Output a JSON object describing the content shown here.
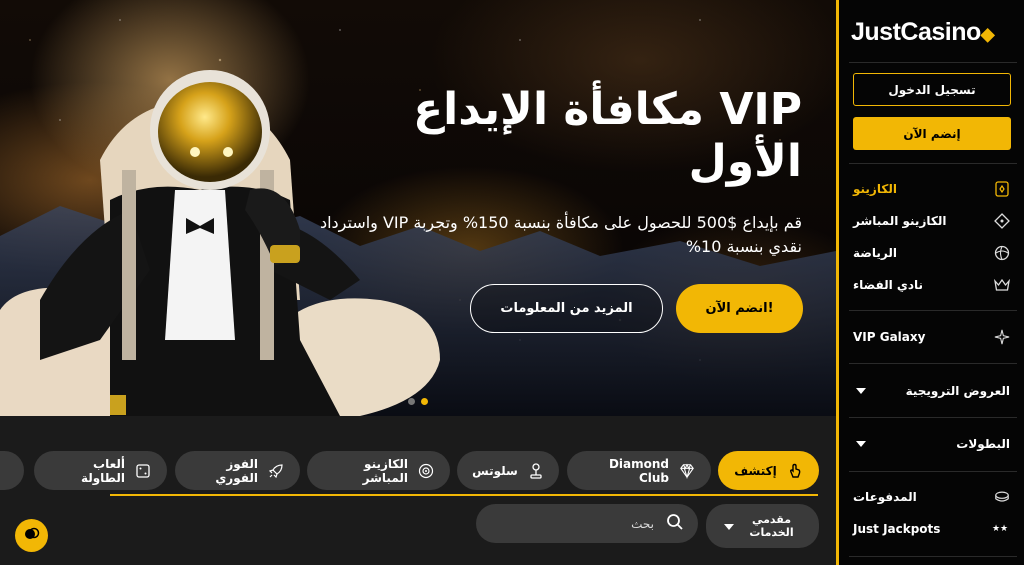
{
  "sidebar": {
    "logo": "JustCasino",
    "login_label": "تسجيل الدخول",
    "join_label": "إنضم الآن",
    "items": [
      {
        "label": "الكازينو",
        "icon": "casino-chip-icon",
        "active": true
      },
      {
        "label": "الكازينو المباشر",
        "icon": "live-diamond-icon"
      },
      {
        "label": "الرياضة",
        "icon": "ball-icon"
      },
      {
        "label": "نادي الفضاء",
        "icon": "crown-icon"
      },
      {
        "label": "VIP Galaxy",
        "icon": "sparkle-icon"
      },
      {
        "label": "العروض الترويجية",
        "icon": "chevron-down-icon"
      },
      {
        "label": "البطولات",
        "icon": "chevron-down-icon"
      },
      {
        "label": "المدفوعات",
        "icon": "coins-icon"
      },
      {
        "label": "Just Jackpots",
        "icon": "stars-icon"
      }
    ]
  },
  "hero": {
    "title": "VIP مكافأة الإيداع الأول",
    "subtitle": "قم بإيداع $500 للحصول على مكافأة بنسبة 150% وتجربة VIP واسترداد نقدي بنسبة 10%",
    "primary_cta": "انضم الآن!",
    "secondary_cta": "المزيد من المعلومات",
    "slides_total": 2,
    "active_slide": 2
  },
  "categories": {
    "chips": [
      {
        "label": "إكتشف",
        "icon": "hand-pointer-icon",
        "active": true
      },
      {
        "label": "Diamond Club",
        "icon": "diamond-icon"
      },
      {
        "label": "سلوتس",
        "icon": "joystick-icon"
      },
      {
        "label": "الكازينو المباشر",
        "icon": "roulette-icon"
      },
      {
        "label": "الفوز الفوري",
        "icon": "rocket-icon"
      },
      {
        "label": "ألعاب الطاولة",
        "icon": "dice-icon"
      }
    ]
  },
  "search": {
    "placeholder": "بحث",
    "providers_label": "مقدمي الخدمات"
  },
  "colors": {
    "accent": "#f2b705",
    "chip_bg": "#3a3a3a",
    "panel_bg": "#1b1b1b"
  }
}
